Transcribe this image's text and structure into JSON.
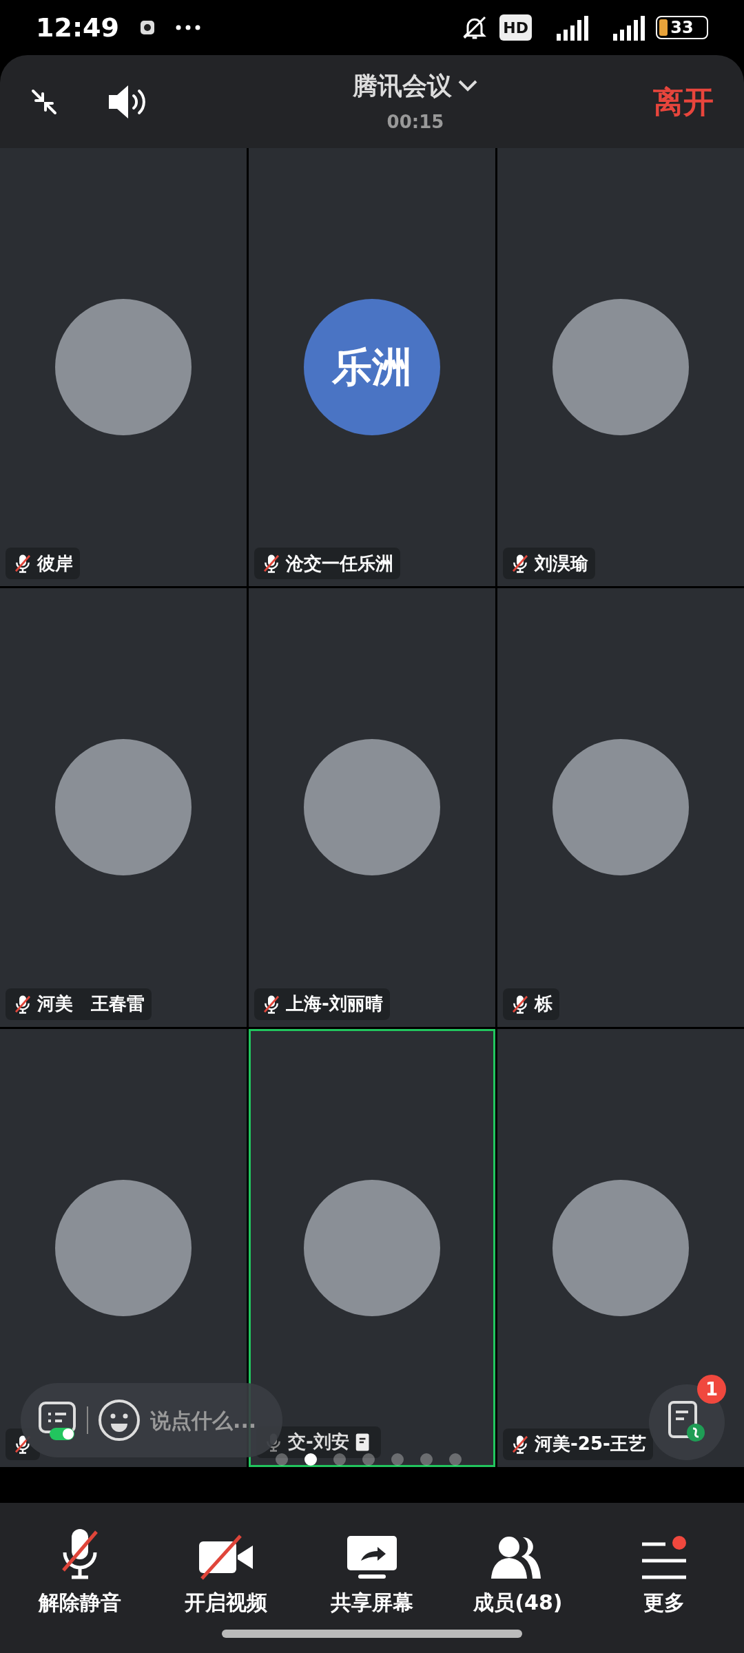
{
  "status_bar": {
    "time": "12:49",
    "hd": "HD",
    "battery": "33"
  },
  "header": {
    "title": "腾讯会议",
    "timer": "00:15",
    "leave": "离开"
  },
  "tiles": [
    {
      "name": "彼岸",
      "muted": true,
      "active": false,
      "avatar": {
        "kind": "photo"
      }
    },
    {
      "name": "沧交一任乐洲",
      "muted": true,
      "active": false,
      "avatar": {
        "kind": "text",
        "text": "乐洲",
        "color": "#4a74c4"
      }
    },
    {
      "name": "刘淏瑜",
      "muted": true,
      "active": false,
      "avatar": {
        "kind": "photo"
      }
    },
    {
      "name": "河美　王春雷",
      "muted": true,
      "active": false,
      "avatar": {
        "kind": "photo"
      }
    },
    {
      "name": "上海-刘丽晴",
      "muted": true,
      "active": false,
      "avatar": {
        "kind": "photo"
      }
    },
    {
      "name": "栎",
      "muted": true,
      "active": false,
      "avatar": {
        "kind": "photo"
      }
    },
    {
      "muted": true,
      "active": false,
      "avatar": {
        "kind": "photo"
      }
    },
    {
      "name": "交-刘安",
      "muted": false,
      "active": true,
      "sharing_doc": true,
      "avatar": {
        "kind": "photo"
      }
    },
    {
      "name": "河美-25-王艺",
      "muted": true,
      "active": false,
      "avatar": {
        "kind": "photo"
      }
    }
  ],
  "page_dots": [
    {
      "selected": false
    },
    {
      "selected": true
    },
    {
      "selected": false
    },
    {
      "selected": false
    },
    {
      "selected": false
    },
    {
      "selected": false
    },
    {
      "selected": false
    }
  ],
  "chat": {
    "placeholder": "说点什么..."
  },
  "notes_badge": "1",
  "toolbar": [
    {
      "kind": "mic",
      "label": "解除静音",
      "off": true
    },
    {
      "kind": "video",
      "label": "开启视频",
      "off": true
    },
    {
      "kind": "share",
      "label": "共享屏幕"
    },
    {
      "kind": "members",
      "label": "成员(48)"
    },
    {
      "kind": "more",
      "label": "更多",
      "dot": true
    }
  ]
}
